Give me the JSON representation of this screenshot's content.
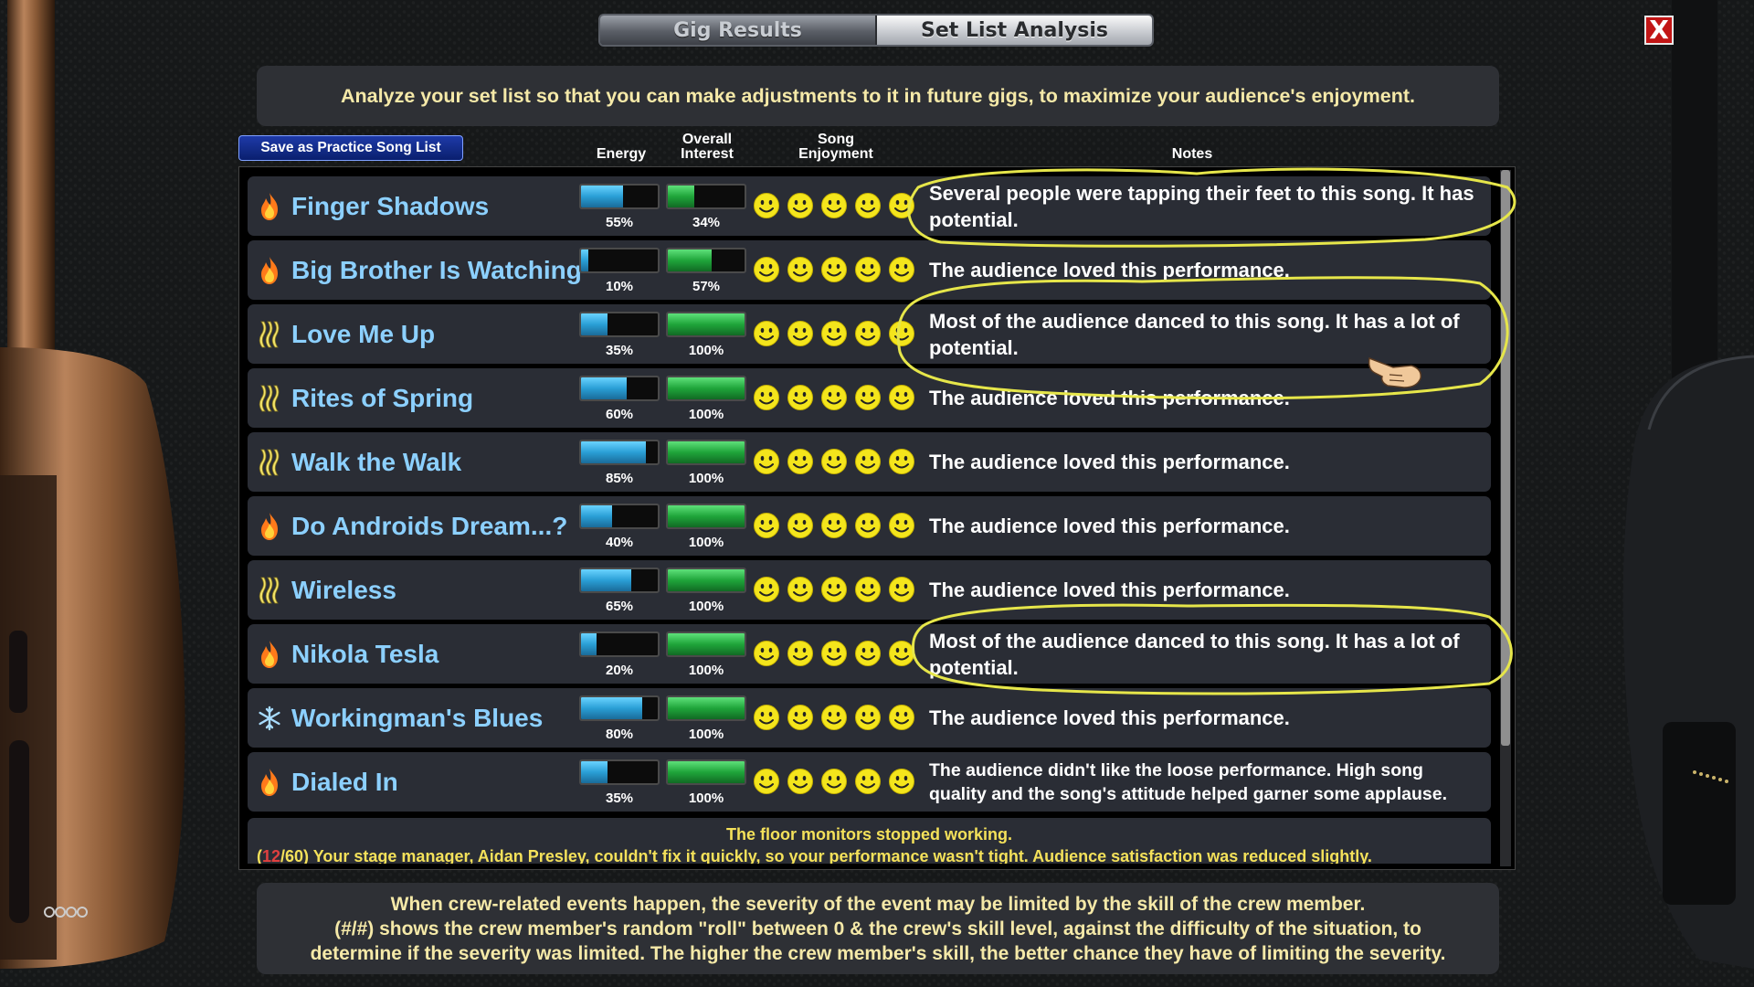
{
  "tabs": {
    "gig_results": "Gig Results",
    "set_list_analysis": "Set List Analysis"
  },
  "close_label": "X",
  "description": "Analyze your set list so that you can make adjustments to it in future gigs, to maximize your audience's enjoyment.",
  "save_button": "Save as Practice Song List",
  "columns": {
    "energy": "Energy",
    "interest_l1": "Overall",
    "interest_l2": "Interest",
    "enjoy_l1": "Song",
    "enjoy_l2": "Enjoyment",
    "notes": "Notes"
  },
  "colors": {
    "song_name": "#8cd0ff",
    "energy_bar": "#2a9fd6",
    "interest_bar": "#1fa53a",
    "notes_text": "#ffffff",
    "event_text": "#f4e15a",
    "highlight_circle": "#e6e64a"
  },
  "songs": [
    {
      "icon": "fire-icon",
      "name": "Finger Shadows",
      "energy": 55,
      "energy_label": "55%",
      "interest": 34,
      "interest_label": "34%",
      "enjoyment": 5,
      "note": "Several people were tapping their feet to this song. It has potential."
    },
    {
      "icon": "fire-icon",
      "name": "Big Brother Is Watching",
      "energy": 10,
      "energy_label": "10%",
      "interest": 57,
      "interest_label": "57%",
      "enjoyment": 5,
      "note": "The audience loved this performance."
    },
    {
      "icon": "waves-icon",
      "name": "Love Me Up",
      "energy": 35,
      "energy_label": "35%",
      "interest": 100,
      "interest_label": "100%",
      "enjoyment": 5,
      "note": "Most of the audience danced to this song. It has a lot of potential."
    },
    {
      "icon": "waves-icon",
      "name": "Rites of Spring",
      "energy": 60,
      "energy_label": "60%",
      "interest": 100,
      "interest_label": "100%",
      "enjoyment": 5,
      "note": "The audience loved this performance."
    },
    {
      "icon": "waves-icon",
      "name": "Walk the Walk",
      "energy": 85,
      "energy_label": "85%",
      "interest": 100,
      "interest_label": "100%",
      "enjoyment": 5,
      "note": "The audience loved this performance."
    },
    {
      "icon": "fire-icon",
      "name": "Do Androids Dream...?",
      "energy": 40,
      "energy_label": "40%",
      "interest": 100,
      "interest_label": "100%",
      "enjoyment": 5,
      "note": "The audience loved this performance."
    },
    {
      "icon": "waves-icon",
      "name": "Wireless",
      "energy": 65,
      "energy_label": "65%",
      "interest": 100,
      "interest_label": "100%",
      "enjoyment": 5,
      "note": "The audience loved this performance."
    },
    {
      "icon": "fire-icon",
      "name": "Nikola Tesla",
      "energy": 20,
      "energy_label": "20%",
      "interest": 100,
      "interest_label": "100%",
      "enjoyment": 5,
      "note": "Most of the audience danced to this song. It has a lot of potential."
    },
    {
      "icon": "snowflake-icon",
      "name": "Workingman's Blues",
      "energy": 80,
      "energy_label": "80%",
      "interest": 100,
      "interest_label": "100%",
      "enjoyment": 5,
      "note": "The audience loved this performance."
    },
    {
      "icon": "fire-icon",
      "name": "Dialed In",
      "energy": 35,
      "energy_label": "35%",
      "interest": 100,
      "interest_label": "100%",
      "enjoyment": 5,
      "note": "The audience didn't like the loose performance. High song quality and the song's attitude helped garner some applause."
    }
  ],
  "event": {
    "title": "The floor monitors stopped working.",
    "roll_open": "(",
    "roll": "12",
    "roll_rest": "/60)",
    "detail": " Your stage manager, Aidan Presley, couldn't fix it quickly, so your performance wasn't tight. Audience satisfaction was reduced slightly."
  },
  "footer": {
    "line1": "When crew-related events happen, the severity of the event may be limited by the skill of the crew member.",
    "line2": "(#/#) shows the crew member's random \"roll\" between 0 & the crew's skill level, against the difficulty of the situation, to",
    "line3": "determine if the severity was limited. The higher the crew member's skill, the better chance they have of limiting the severity."
  }
}
